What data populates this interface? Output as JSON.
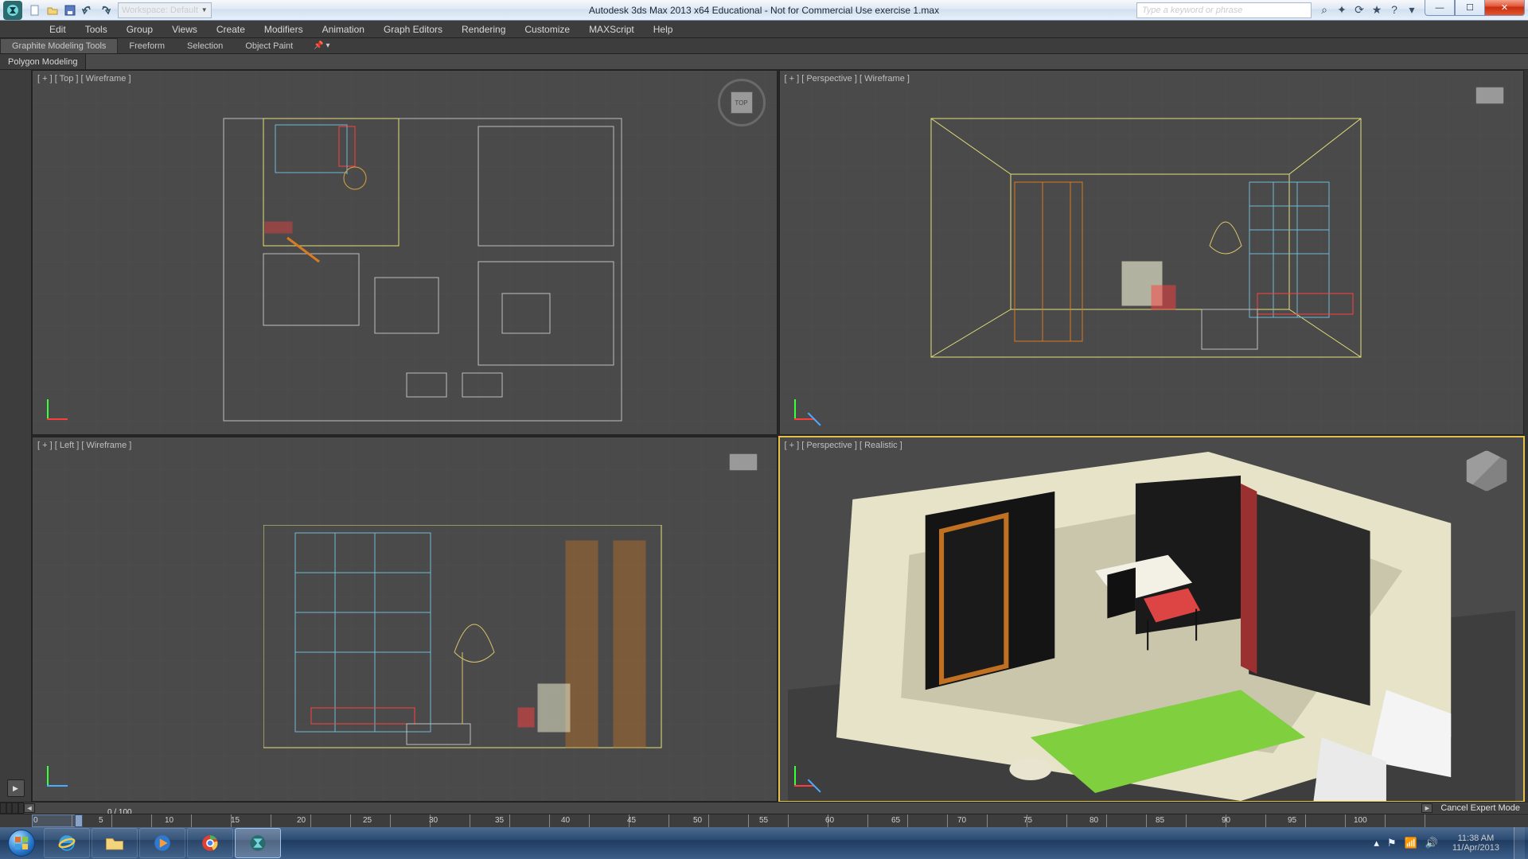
{
  "app": {
    "title": "Autodesk 3ds Max 2013 x64   Educational - Not for Commercial Use   exercise 1.max",
    "workspace_label": "Workspace: Default",
    "search_placeholder": "Type a keyword or phrase"
  },
  "menu": [
    "Edit",
    "Tools",
    "Group",
    "Views",
    "Create",
    "Modifiers",
    "Animation",
    "Graph Editors",
    "Rendering",
    "Customize",
    "MAXScript",
    "Help"
  ],
  "ribbon": {
    "tabs": [
      "Graphite Modeling Tools",
      "Freeform",
      "Selection",
      "Object Paint"
    ],
    "active": 0,
    "subtab": "Polygon Modeling"
  },
  "viewports": [
    {
      "plus": "[ + ]",
      "view": "[ Top ]",
      "shade": "[ Wireframe ]"
    },
    {
      "plus": "[ + ]",
      "view": "[ Perspective ]",
      "shade": "[ Wireframe ]"
    },
    {
      "plus": "[ + ]",
      "view": "[ Left ]",
      "shade": "[ Wireframe ]"
    },
    {
      "plus": "[ + ]",
      "view": "[ Perspective ]",
      "shade": "[ Realistic ]"
    }
  ],
  "timeline": {
    "frame_display": "0 / 100",
    "ticks": [
      "0",
      "5",
      "10",
      "15",
      "20",
      "25",
      "30",
      "35",
      "40",
      "45",
      "50",
      "55",
      "60",
      "65",
      "70",
      "75",
      "80",
      "85",
      "90",
      "95",
      "100"
    ],
    "expert_label": "Cancel Expert Mode"
  },
  "taskbar": {
    "items": [
      "internet-explorer",
      "file-explorer",
      "windows-media-player",
      "google-chrome",
      "3ds-max"
    ],
    "active": 4,
    "tray_time": "11:38 AM",
    "tray_date": "11/Apr/2013"
  },
  "win_buttons": {
    "min": "—",
    "max": "☐",
    "close": "✕"
  },
  "title_icons": [
    "⌕",
    "✦",
    "⟳",
    "★",
    "?",
    "▾"
  ]
}
